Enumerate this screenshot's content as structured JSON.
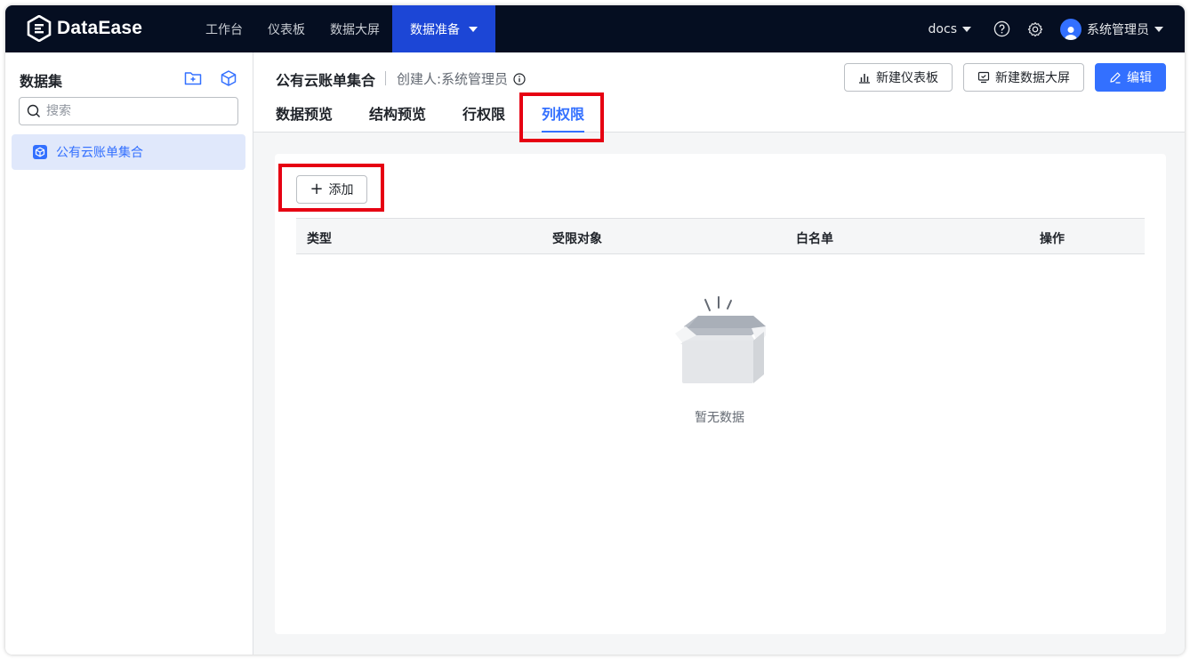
{
  "brand": {
    "name": "DataEase"
  },
  "nav": [
    {
      "label": "工作台"
    },
    {
      "label": "仪表板"
    },
    {
      "label": "数据大屏"
    },
    {
      "label": "数据准备"
    }
  ],
  "topbar": {
    "docs_label": "docs",
    "user_name": "系统管理员"
  },
  "sidebar": {
    "title": "数据集",
    "search_placeholder": "搜索",
    "items": [
      {
        "label": "公有云账单集合"
      }
    ]
  },
  "header": {
    "dataset_name": "公有云账单集合",
    "creator": "创建人:系统管理员",
    "buttons": {
      "new_dashboard": "新建仪表板",
      "new_screen": "新建数据大屏",
      "edit": "编辑"
    },
    "tabs": [
      {
        "label": "数据预览"
      },
      {
        "label": "结构预览"
      },
      {
        "label": "行权限"
      },
      {
        "label": "列权限"
      }
    ],
    "active_tab": "列权限"
  },
  "content": {
    "add_label": "添加",
    "columns": [
      "类型",
      "受限对象",
      "白名单",
      "操作"
    ],
    "rows": [],
    "empty_text": "暂无数据"
  },
  "colors": {
    "accent": "#3370ff",
    "topbar": "#050e21",
    "highlight": "#e60012"
  }
}
